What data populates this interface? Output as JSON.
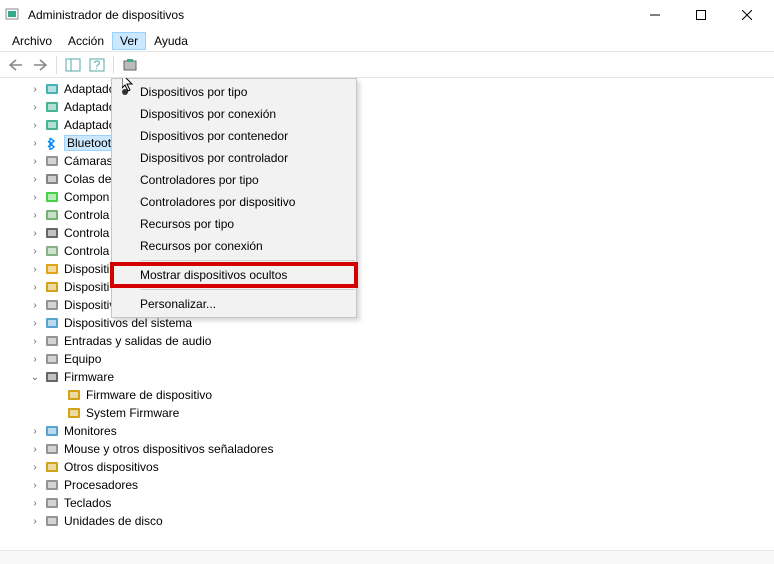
{
  "window": {
    "title": "Administrador de dispositivos"
  },
  "menubar": {
    "items": [
      "Archivo",
      "Acción",
      "Ver",
      "Ayuda"
    ],
    "active_index": 2
  },
  "dropdown": {
    "items": [
      {
        "label": "Dispositivos por tipo",
        "bullet": true
      },
      {
        "label": "Dispositivos por conexión"
      },
      {
        "label": "Dispositivos por contenedor"
      },
      {
        "label": "Dispositivos por controlador"
      },
      {
        "label": "Controladores por tipo"
      },
      {
        "label": "Controladores por dispositivo"
      },
      {
        "label": "Recursos por tipo"
      },
      {
        "label": "Recursos por conexión"
      },
      {
        "sep": true
      },
      {
        "label": "Mostrar dispositivos ocultos",
        "highlight": true
      },
      {
        "sep": true
      },
      {
        "label": "Personalizar..."
      }
    ]
  },
  "tree": [
    {
      "label": "Adaptado",
      "icon": "display-icon",
      "expander": ">",
      "indent": 1
    },
    {
      "label": "Adaptado",
      "icon": "network-icon",
      "expander": ">",
      "indent": 1
    },
    {
      "label": "Adaptado",
      "icon": "network-icon",
      "expander": ">",
      "indent": 1
    },
    {
      "label": "Bluetooth",
      "icon": "bluetooth-icon",
      "expander": ">",
      "indent": 1,
      "highlighted": true
    },
    {
      "label": "Cámaras",
      "icon": "camera-icon",
      "expander": ">",
      "indent": 1
    },
    {
      "label": "Colas de",
      "icon": "printer-icon",
      "expander": ">",
      "indent": 1
    },
    {
      "label": "Compon",
      "icon": "component-icon",
      "expander": ">",
      "indent": 1
    },
    {
      "label": "Controla",
      "icon": "sound-icon",
      "expander": ">",
      "indent": 1
    },
    {
      "label": "Controla",
      "icon": "usb-icon",
      "expander": ">",
      "indent": 1
    },
    {
      "label": "Controla",
      "icon": "storage-icon",
      "expander": ">",
      "indent": 1
    },
    {
      "label": "Dispositi",
      "icon": "hid-icon",
      "expander": ">",
      "indent": 1
    },
    {
      "label": "Dispositi",
      "icon": "battery-icon",
      "expander": ">",
      "indent": 1
    },
    {
      "label": "Dispositivos de software",
      "icon": "software-icon",
      "expander": ">",
      "indent": 1
    },
    {
      "label": "Dispositivos del sistema",
      "icon": "system-icon",
      "expander": ">",
      "indent": 1
    },
    {
      "label": "Entradas y salidas de audio",
      "icon": "audio-icon",
      "expander": ">",
      "indent": 1
    },
    {
      "label": "Equipo",
      "icon": "computer-icon",
      "expander": ">",
      "indent": 1
    },
    {
      "label": "Firmware",
      "icon": "firmware-icon",
      "expander": "v",
      "indent": 1
    },
    {
      "label": "Firmware de dispositivo",
      "icon": "firmware-child-icon",
      "expander": "",
      "indent": 2
    },
    {
      "label": "System Firmware",
      "icon": "firmware-child-icon",
      "expander": "",
      "indent": 2
    },
    {
      "label": "Monitores",
      "icon": "monitor-icon",
      "expander": ">",
      "indent": 1
    },
    {
      "label": "Mouse y otros dispositivos señaladores",
      "icon": "mouse-icon",
      "expander": ">",
      "indent": 1
    },
    {
      "label": "Otros dispositivos",
      "icon": "other-icon",
      "expander": ">",
      "indent": 1
    },
    {
      "label": "Procesadores",
      "icon": "cpu-icon",
      "expander": ">",
      "indent": 1
    },
    {
      "label": "Teclados",
      "icon": "keyboard-icon",
      "expander": ">",
      "indent": 1
    },
    {
      "label": "Unidades de disco",
      "icon": "disk-icon",
      "expander": ">",
      "indent": 1
    }
  ]
}
